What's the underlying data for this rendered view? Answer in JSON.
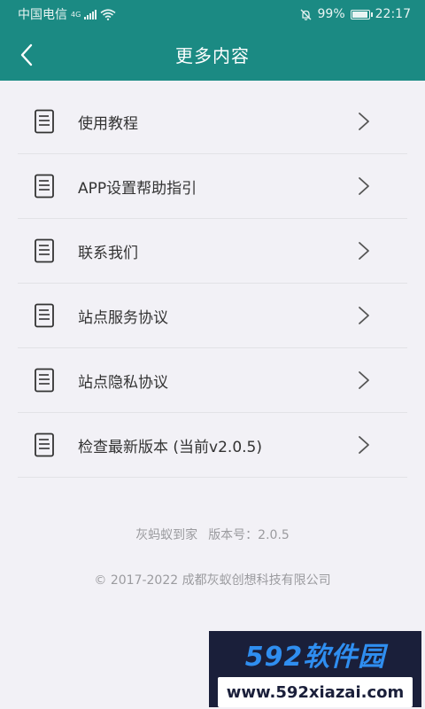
{
  "status_bar": {
    "carrier": "中国电信",
    "network": "4G",
    "battery_percent": "99%",
    "battery_level": 0.99,
    "time": "22:17"
  },
  "header": {
    "title": "更多内容",
    "back_icon": "chevron-left-icon",
    "background": "#1b8a83"
  },
  "menu": {
    "items": [
      {
        "label": "使用教程",
        "icon": "document-icon"
      },
      {
        "label": "APP设置帮助指引",
        "icon": "document-icon"
      },
      {
        "label": "联系我们",
        "icon": "document-icon"
      },
      {
        "label": "站点服务协议",
        "icon": "document-icon"
      },
      {
        "label": "站点隐私协议",
        "icon": "document-icon"
      },
      {
        "label": "检查最新版本 (当前v2.0.5)",
        "icon": "document-icon"
      }
    ]
  },
  "footer": {
    "app_name": "灰蚂蚁到家",
    "version_label": "版本号：2.0.5",
    "copyright": "© 2017-2022 成都灰蚁创想科技有限公司"
  },
  "watermark": {
    "brand": "592软件园",
    "url": "www.592xiazai.com"
  }
}
